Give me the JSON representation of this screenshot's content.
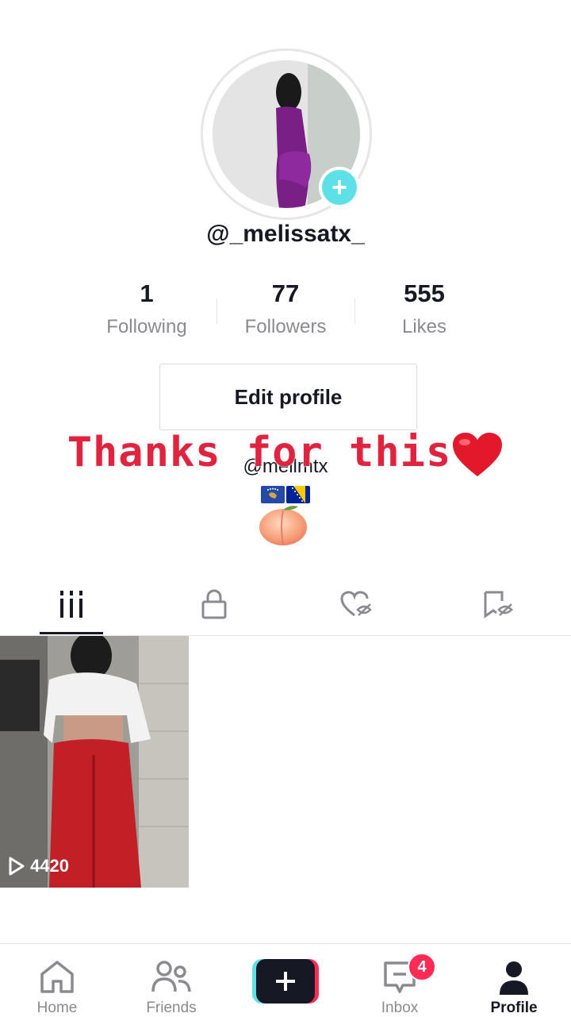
{
  "profile": {
    "username": "@_melissatx_",
    "bio_handle": "@mellmtx",
    "overlay_text": "Thanks for this"
  },
  "stats": {
    "following": {
      "value": "1",
      "label": "Following"
    },
    "followers": {
      "value": "77",
      "label": "Followers"
    },
    "likes": {
      "value": "555",
      "label": "Likes"
    }
  },
  "actions": {
    "edit_profile": "Edit profile"
  },
  "tabs": [
    {
      "name": "videos",
      "icon": "grid-icon",
      "active": true
    },
    {
      "name": "private",
      "icon": "lock-icon",
      "active": false
    },
    {
      "name": "liked",
      "icon": "heart-hidden-icon",
      "active": false
    },
    {
      "name": "favorites",
      "icon": "bookmark-hidden-icon",
      "active": false
    }
  ],
  "videos": [
    {
      "views": "4420"
    }
  ],
  "nav": {
    "home": "Home",
    "friends": "Friends",
    "inbox": "Inbox",
    "inbox_badge": "4",
    "profile": "Profile"
  },
  "colors": {
    "accent": "#fe2c55",
    "teal": "#5ee0e8",
    "text": "#161823",
    "muted": "#8a8b91"
  }
}
